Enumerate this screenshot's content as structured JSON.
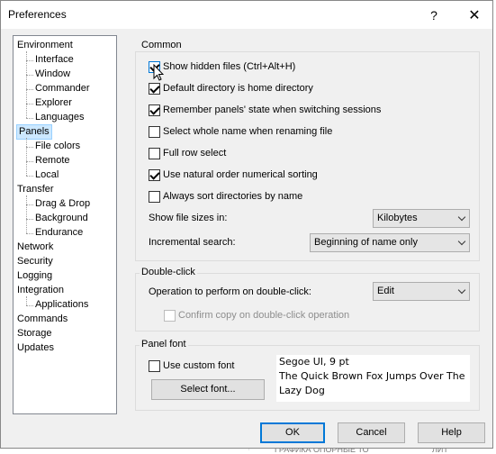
{
  "background": {
    "bottom_text_left": "ГРАФИКА ОПОРНЫЕ ТО",
    "bottom_text_right": "ЛИТ"
  },
  "window": {
    "title": "Preferences",
    "help_glyph": "?",
    "close_glyph": "✕"
  },
  "tree": {
    "items": [
      {
        "label": "Environment",
        "level": 0
      },
      {
        "label": "Interface",
        "level": 1
      },
      {
        "label": "Window",
        "level": 1
      },
      {
        "label": "Commander",
        "level": 1
      },
      {
        "label": "Explorer",
        "level": 1
      },
      {
        "label": "Languages",
        "level": 1
      },
      {
        "label": "Panels",
        "level": 0,
        "selected": true
      },
      {
        "label": "File colors",
        "level": 1
      },
      {
        "label": "Remote",
        "level": 1
      },
      {
        "label": "Local",
        "level": 1
      },
      {
        "label": "Transfer",
        "level": 0
      },
      {
        "label": "Drag & Drop",
        "level": 1
      },
      {
        "label": "Background",
        "level": 1
      },
      {
        "label": "Endurance",
        "level": 1
      },
      {
        "label": "Network",
        "level": 0
      },
      {
        "label": "Security",
        "level": 0
      },
      {
        "label": "Logging",
        "level": 0
      },
      {
        "label": "Integration",
        "level": 0
      },
      {
        "label": "Applications",
        "level": 1
      },
      {
        "label": "Commands",
        "level": 0
      },
      {
        "label": "Storage",
        "level": 0
      },
      {
        "label": "Updates",
        "level": 0
      }
    ]
  },
  "common": {
    "title": "Common",
    "checkboxes": [
      {
        "label": "Show hidden files (Ctrl+Alt+H)",
        "checked": true
      },
      {
        "label": "Default directory is home directory",
        "checked": true
      },
      {
        "label": "Remember panels' state when switching sessions",
        "checked": true
      },
      {
        "label": "Select whole name when renaming file",
        "checked": false
      },
      {
        "label": "Full row select",
        "checked": false
      },
      {
        "label": "Use natural order numerical sorting",
        "checked": true
      },
      {
        "label": "Always sort directories by name",
        "checked": false
      }
    ],
    "file_sizes_label": "Show file sizes in:",
    "file_sizes_value": "Kilobytes",
    "incremental_label": "Incremental search:",
    "incremental_value": "Beginning of name only"
  },
  "double_click": {
    "title": "Double-click",
    "operation_label": "Operation to perform on double-click:",
    "operation_value": "Edit",
    "confirm_label": "Confirm copy on double-click operation",
    "confirm_checked": false
  },
  "panel_font": {
    "title": "Panel font",
    "custom_label": "Use custom font",
    "custom_checked": false,
    "select_button": "Select font...",
    "font_name": "Segoe UI, 9 pt",
    "sample_line1": "The Quick Brown Fox Jumps Over The",
    "sample_line2": "Lazy Dog"
  },
  "buttons": {
    "ok": "OK",
    "cancel": "Cancel",
    "help": "Help"
  }
}
